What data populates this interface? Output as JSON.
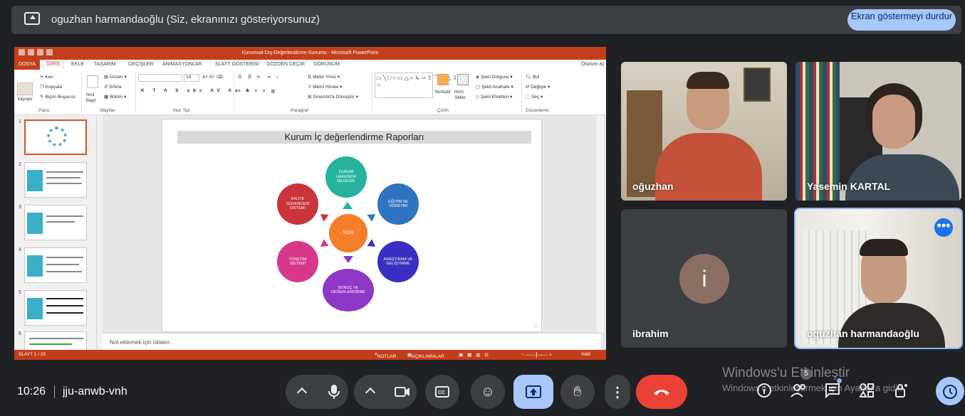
{
  "banner": {
    "text": "oguzhan harmandaoğlu (Siz, ekranınızı gösteriyorsunuz)",
    "stop_label": "Ekran göstermeyi durdur"
  },
  "ppt": {
    "window_title": "Kurumsal-Dış-Değerlendirme-Sunumu - Microsoft PowerPoint",
    "signin": "Oturum aç",
    "tabs": [
      "DOSYA",
      "GİRİŞ",
      "EKLE",
      "TASARIM",
      "GEÇİŞLER",
      "ANİMASYONLAR",
      "SLAYT GÖSTERİSİ",
      "GÖZDEN GEÇİR",
      "GÖRÜNÜM"
    ],
    "ribbon": {
      "pano": {
        "label": "Pano",
        "paste": "Yapıştır",
        "cut": "Kes",
        "copy": "Kopyala",
        "format_painter": "Biçim Boyacısı"
      },
      "slaytlar": {
        "label": "Slaytlar",
        "new_slide": "Yeni Slayt",
        "layout": "Düzen",
        "reset": "Sıfırla",
        "section": "Bölüm"
      },
      "yazi_tipi": {
        "label": "Yazı Tipi",
        "font_size": "14"
      },
      "paragraf": {
        "label": "Paragraf",
        "text_direction": "Metin Yönü",
        "align_text": "Metni Hizala",
        "smartart": "SmartArt'a Dönüştür"
      },
      "cizim": {
        "label": "Çizim",
        "arrange": "Yerleştir",
        "quick_styles": "Hızlı Stiller",
        "shape_fill": "Şekil Dolgusu",
        "shape_outline": "Şekil Anahattı",
        "shape_effects": "Şekil Efektleri"
      },
      "duzenleme": {
        "label": "Düzenleme",
        "find": "Bul",
        "replace": "Değiştir",
        "select": "Seç"
      }
    },
    "thumb_numbers": [
      "1",
      "2",
      "3",
      "4",
      "5",
      "6"
    ],
    "slide": {
      "title": "Kurum İç değerlendirme Raporları",
      "center": "KİDR",
      "nodes": {
        "top": "KURUM HAKKINDA BİLGİLER",
        "upper_right": "EĞİTİM VE ÖĞRETİM",
        "lower_right": "ARAŞTIRMA VE GELİŞTİRME",
        "bottom": "SONUÇ VE DEĞERLENDİRME",
        "lower_left": "YÖNETİM SİSTEMİ",
        "upper_left": "KALİTE GÜVENCESİ SİSTEMİ"
      },
      "page_number": "1",
      "colors": {
        "top": "#26b39d",
        "upper_right": "#2f74c0",
        "lower_right": "#3a2fc2",
        "bottom": "#8f37c7",
        "lower_left": "#d8388b",
        "upper_left": "#c9353a",
        "center": "#f57f29"
      }
    },
    "notes_placeholder": "Not eklemek için tıklatın",
    "status": {
      "slide_count": "SLAYT 1 / 25",
      "notes": "NOTLAR",
      "comments": "AÇIKLAMALAR",
      "zoom": "%69"
    }
  },
  "participants": [
    {
      "name": "oğuzhan"
    },
    {
      "name": "Yasemin KARTAL"
    },
    {
      "name": "ibrahim",
      "avatar_letter": "i"
    },
    {
      "name": "oguzhan harmandaoğlu"
    }
  ],
  "bottom_bar": {
    "time": "10:26",
    "meeting_code": "jju-anwb-vnh",
    "people_count": "5"
  },
  "watermark": {
    "line1": "Windows'u Etkinleştir",
    "line2": "Windows'u etkinleştirmek için Ayarlar'a gidin."
  },
  "icons": [
    "present-icon",
    "mic-icon",
    "camera-icon",
    "captions-icon",
    "emoji-icon",
    "present-now-icon",
    "raise-hand-icon",
    "more-options-icon",
    "end-call-icon",
    "info-icon",
    "people-icon",
    "chat-icon",
    "activities-icon",
    "host-controls-icon",
    "timer-icon"
  ],
  "accent_colors": {
    "ppt": "#c43e1c",
    "meet_blue": "#a8c7fa",
    "end_call": "#ea4335"
  }
}
